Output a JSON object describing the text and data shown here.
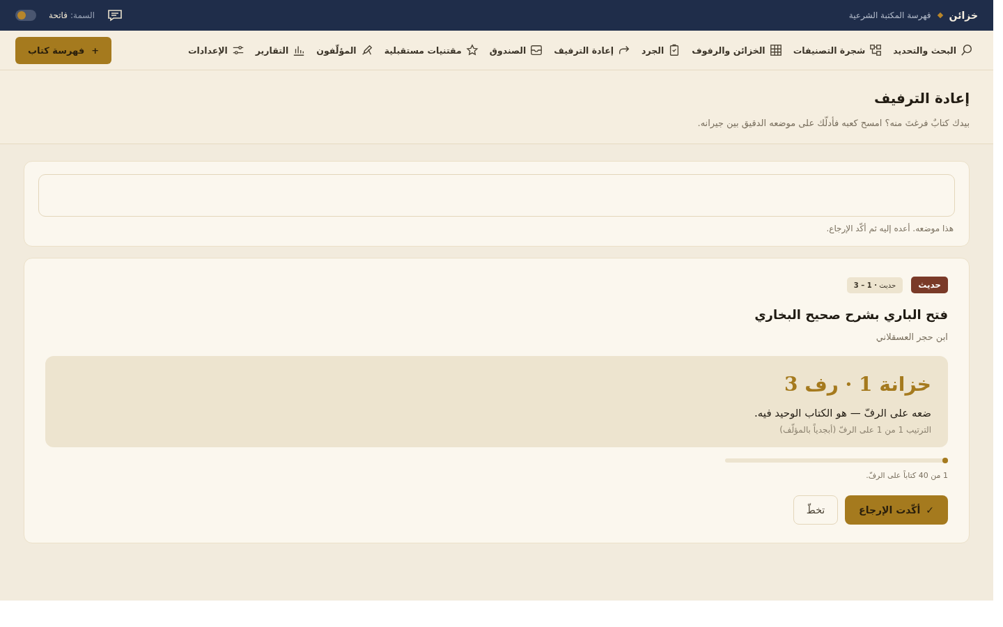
{
  "top_bar": {
    "brand": "خزائن",
    "subtitle": "فهرسة المكتبة الشرعية",
    "theme_label": "السمة:",
    "theme_value": "فاتحة",
    "theme_toggle": {
      "on": false
    }
  },
  "nav": {
    "items": [
      {
        "label": "البحث والتحديد",
        "selected": false
      },
      {
        "label": "شجرة التصنيفات",
        "selected": false
      },
      {
        "label": "الخزائن والرفوف",
        "selected": false
      },
      {
        "label": "الجرد",
        "selected": false
      },
      {
        "label": "إعادة الترفيف",
        "selected": false
      },
      {
        "label": "الصندوق",
        "selected": false
      },
      {
        "label": "مقتنيات مستقبلية",
        "selected": false
      },
      {
        "label": "المؤلّفون",
        "selected": false
      },
      {
        "label": "التقارير",
        "selected": false
      },
      {
        "label": "الإعدادات",
        "selected": false
      }
    ],
    "action": {
      "icon": "+",
      "label": "فهرسة كتاب"
    }
  },
  "page_header": {
    "title": "إعادة الترفيف",
    "description": "بيدك كتابٌ فرغتَ منه؟ امسح كعبه فأدلّك على موضعه الدقيق بين جيرانه."
  },
  "scan": {
    "hint": "هذا موضعه. أعده إليه ثم أكّد الإرجاع."
  },
  "result": {
    "tag": "حديث",
    "reference": "حديث **· 1 – 3**",
    "title": "فتح الباري بشرح صحيح البخاري",
    "author": "ابن حجر العسقلاني",
    "location": {
      "place": "خزانة 1 · رف 3",
      "instruction": "ضعه على الرفّ — هو الكتاب الوحيد فيه.",
      "order": "الترتيب 1 من 1 على الرفّ (أبجدياً بالمؤلّف)"
    },
    "progress": {
      "level": 0.025,
      "reading": "1 من 40 كتاباً على الرفّ."
    },
    "confirm": {
      "icon": "✓",
      "label": "أكّدت الإرجاع"
    },
    "skip": {
      "label": "تخطّ"
    }
  }
}
